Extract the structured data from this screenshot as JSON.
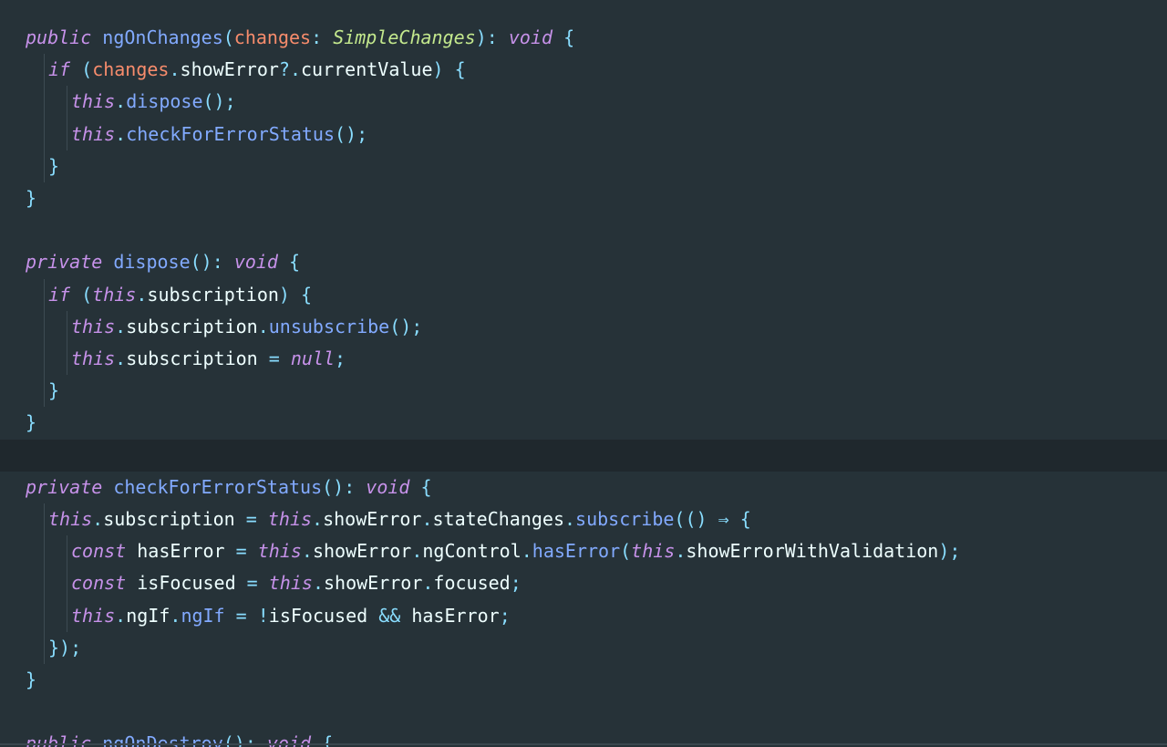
{
  "colors": {
    "background": "#263238",
    "current_line": "#1F282D",
    "keyword": "#C792EA",
    "function": "#82AAFF",
    "parameter": "#F78C6C",
    "type": "#C3E88D",
    "punctuation": "#89DDFF",
    "text": "#EEFFFF"
  },
  "current_line_index": 13,
  "lines": [
    {
      "indent": 0,
      "tokens": [
        [
          "kw",
          "public"
        ],
        [
          "p",
          " "
        ],
        [
          "fn",
          "ngOnChanges"
        ],
        [
          "pu",
          "("
        ],
        [
          "pa",
          "changes"
        ],
        [
          "pu",
          ": "
        ],
        [
          "ty",
          "SimpleChanges"
        ],
        [
          "pu",
          "): "
        ],
        [
          "kw",
          "void"
        ],
        [
          "p",
          " "
        ],
        [
          "pu",
          "{"
        ]
      ]
    },
    {
      "indent": 1,
      "tokens": [
        [
          "kw",
          "if"
        ],
        [
          "p",
          " "
        ],
        [
          "pu",
          "("
        ],
        [
          "pa",
          "changes"
        ],
        [
          "pu",
          "."
        ],
        [
          "p",
          "showError"
        ],
        [
          "pu",
          "?."
        ],
        [
          "p",
          "currentValue"
        ],
        [
          "pu",
          ")"
        ],
        [
          "p",
          " "
        ],
        [
          "pu",
          "{"
        ]
      ]
    },
    {
      "indent": 2,
      "tokens": [
        [
          "kw",
          "this"
        ],
        [
          "pu",
          "."
        ],
        [
          "fn",
          "dispose"
        ],
        [
          "pu",
          "();"
        ]
      ]
    },
    {
      "indent": 2,
      "tokens": [
        [
          "kw",
          "this"
        ],
        [
          "pu",
          "."
        ],
        [
          "fn",
          "checkForErrorStatus"
        ],
        [
          "pu",
          "();"
        ]
      ]
    },
    {
      "indent": 1,
      "tokens": [
        [
          "pu",
          "}"
        ]
      ]
    },
    {
      "indent": 0,
      "tokens": [
        [
          "pu",
          "}"
        ]
      ]
    },
    {
      "indent": 0,
      "tokens": []
    },
    {
      "indent": 0,
      "tokens": [
        [
          "kw",
          "private"
        ],
        [
          "p",
          " "
        ],
        [
          "fn",
          "dispose"
        ],
        [
          "pu",
          "(): "
        ],
        [
          "kw",
          "void"
        ],
        [
          "p",
          " "
        ],
        [
          "pu",
          "{"
        ]
      ]
    },
    {
      "indent": 1,
      "tokens": [
        [
          "kw",
          "if"
        ],
        [
          "p",
          " "
        ],
        [
          "pu",
          "("
        ],
        [
          "kw",
          "this"
        ],
        [
          "pu",
          "."
        ],
        [
          "p",
          "subscription"
        ],
        [
          "pu",
          ")"
        ],
        [
          "p",
          " "
        ],
        [
          "pu",
          "{"
        ]
      ]
    },
    {
      "indent": 2,
      "tokens": [
        [
          "kw",
          "this"
        ],
        [
          "pu",
          "."
        ],
        [
          "p",
          "subscription"
        ],
        [
          "pu",
          "."
        ],
        [
          "fn",
          "unsubscribe"
        ],
        [
          "pu",
          "();"
        ]
      ]
    },
    {
      "indent": 2,
      "tokens": [
        [
          "kw",
          "this"
        ],
        [
          "pu",
          "."
        ],
        [
          "p",
          "subscription "
        ],
        [
          "op",
          "="
        ],
        [
          "p",
          " "
        ],
        [
          "kw",
          "null"
        ],
        [
          "pu",
          ";"
        ]
      ]
    },
    {
      "indent": 1,
      "tokens": [
        [
          "pu",
          "}"
        ]
      ]
    },
    {
      "indent": 0,
      "tokens": [
        [
          "pu",
          "}"
        ]
      ]
    },
    {
      "indent": 0,
      "tokens": []
    },
    {
      "indent": 0,
      "tokens": [
        [
          "kw",
          "private"
        ],
        [
          "p",
          " "
        ],
        [
          "fn",
          "checkForErrorStatus"
        ],
        [
          "pu",
          "(): "
        ],
        [
          "kw",
          "void"
        ],
        [
          "p",
          " "
        ],
        [
          "pu",
          "{"
        ]
      ]
    },
    {
      "indent": 1,
      "tokens": [
        [
          "kw",
          "this"
        ],
        [
          "pu",
          "."
        ],
        [
          "p",
          "subscription "
        ],
        [
          "op",
          "="
        ],
        [
          "p",
          " "
        ],
        [
          "kw",
          "this"
        ],
        [
          "pu",
          "."
        ],
        [
          "p",
          "showError"
        ],
        [
          "pu",
          "."
        ],
        [
          "p",
          "stateChanges"
        ],
        [
          "pu",
          "."
        ],
        [
          "fn",
          "subscribe"
        ],
        [
          "pu",
          "(() "
        ],
        [
          "op",
          "⇒"
        ],
        [
          "p",
          " "
        ],
        [
          "pu",
          "{"
        ]
      ]
    },
    {
      "indent": 2,
      "tokens": [
        [
          "kw",
          "const"
        ],
        [
          "p",
          " hasError "
        ],
        [
          "op",
          "="
        ],
        [
          "p",
          " "
        ],
        [
          "kw",
          "this"
        ],
        [
          "pu",
          "."
        ],
        [
          "p",
          "showError"
        ],
        [
          "pu",
          "."
        ],
        [
          "p",
          "ngControl"
        ],
        [
          "pu",
          "."
        ],
        [
          "fn",
          "hasError"
        ],
        [
          "pu",
          "("
        ],
        [
          "kw",
          "this"
        ],
        [
          "pu",
          "."
        ],
        [
          "p",
          "showErrorWithValidation"
        ],
        [
          "pu",
          ");"
        ]
      ]
    },
    {
      "indent": 2,
      "tokens": [
        [
          "kw",
          "const"
        ],
        [
          "p",
          " isFocused "
        ],
        [
          "op",
          "="
        ],
        [
          "p",
          " "
        ],
        [
          "kw",
          "this"
        ],
        [
          "pu",
          "."
        ],
        [
          "p",
          "showError"
        ],
        [
          "pu",
          "."
        ],
        [
          "p",
          "focused"
        ],
        [
          "pu",
          ";"
        ]
      ]
    },
    {
      "indent": 2,
      "tokens": [
        [
          "kw",
          "this"
        ],
        [
          "pu",
          "."
        ],
        [
          "p",
          "ngIf"
        ],
        [
          "pu",
          "."
        ],
        [
          "fn",
          "ngIf"
        ],
        [
          "p",
          " "
        ],
        [
          "op",
          "="
        ],
        [
          "p",
          " "
        ],
        [
          "op",
          "!"
        ],
        [
          "p",
          "isFocused "
        ],
        [
          "op",
          "&&"
        ],
        [
          "p",
          " hasError"
        ],
        [
          "pu",
          ";"
        ]
      ]
    },
    {
      "indent": 1,
      "tokens": [
        [
          "pu",
          "});"
        ]
      ]
    },
    {
      "indent": 0,
      "tokens": [
        [
          "pu",
          "}"
        ]
      ]
    },
    {
      "indent": 0,
      "tokens": []
    },
    {
      "indent": 0,
      "tokens": [
        [
          "kw",
          "public"
        ],
        [
          "p",
          " "
        ],
        [
          "fn",
          "ngOnDestroy"
        ],
        [
          "pu",
          "(): "
        ],
        [
          "kw",
          "void"
        ],
        [
          "p",
          " "
        ],
        [
          "pu",
          "{"
        ]
      ]
    }
  ]
}
